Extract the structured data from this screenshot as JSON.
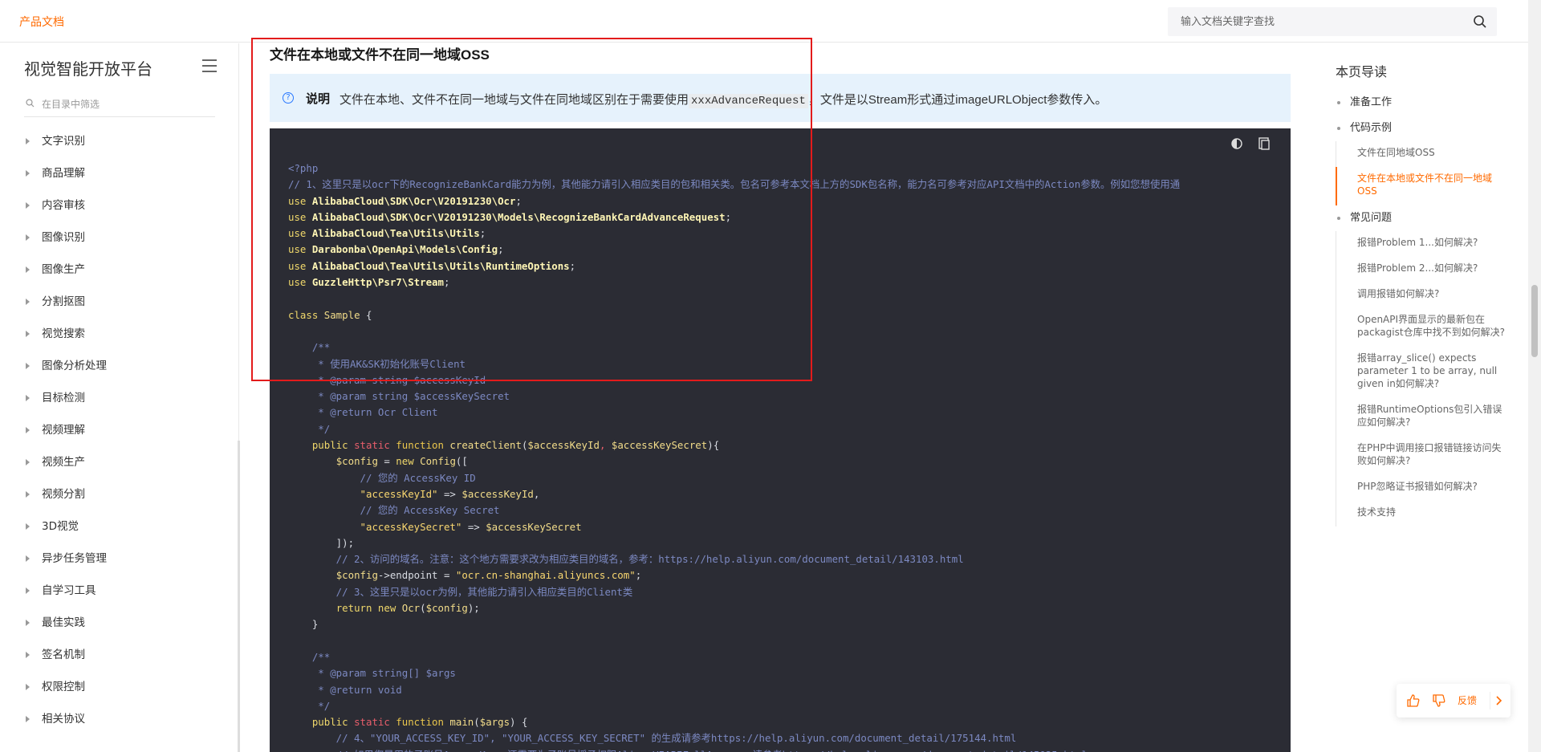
{
  "header": {
    "brand": "产品文档",
    "search_placeholder": "输入文档关键字查找"
  },
  "sidebar": {
    "title": "视觉智能开放平台",
    "filter_placeholder": "在目录中筛选",
    "items": [
      "文字识别",
      "商品理解",
      "内容审核",
      "图像识别",
      "图像生产",
      "分割抠图",
      "视觉搜索",
      "图像分析处理",
      "目标检测",
      "视频理解",
      "视频生产",
      "视频分割",
      "3D视觉",
      "异步任务管理",
      "自学习工具",
      "最佳实践",
      "签名机制",
      "权限控制",
      "相关协议"
    ]
  },
  "main": {
    "heading": "文件在本地或文件不在同一地域OSS",
    "note_label": "说明",
    "note_text_1": "文件在本地、文件不在同一地域与文件在同地域区别在于需要使用",
    "note_code": "xxxAdvanceRequest",
    "note_text_2": "，文件是以Stream形式通过imageURLObject参数传入。"
  },
  "code_lines": [
    [
      {
        "t": "<?php",
        "c": "c-ph"
      }
    ],
    [
      {
        "t": "// 1、这里只是以ocr下的RecognizeBankCard能力为例，其他能力请引入相应类目的包和相关类。包名可参考本文档上方的SDK包名称，能力名可参考对应API文档中的Action参数。例如您想使用通",
        "c": "c-cm"
      }
    ],
    [
      {
        "t": "use ",
        "c": "c-kw"
      },
      {
        "t": "AlibabaCloud\\SDK\\Ocr\\V20191230\\Ocr",
        "c": "c-mo"
      },
      {
        "t": ";",
        "c": "c-pl"
      }
    ],
    [
      {
        "t": "use ",
        "c": "c-kw"
      },
      {
        "t": "AlibabaCloud\\SDK\\Ocr\\V20191230\\Models\\RecognizeBankCardAdvanceRequest",
        "c": "c-mo"
      },
      {
        "t": ";",
        "c": "c-pl"
      }
    ],
    [
      {
        "t": "use ",
        "c": "c-kw"
      },
      {
        "t": "AlibabaCloud\\Tea\\Utils\\Utils",
        "c": "c-mo"
      },
      {
        "t": ";",
        "c": "c-pl"
      }
    ],
    [
      {
        "t": "use ",
        "c": "c-kw"
      },
      {
        "t": "Darabonba\\OpenApi\\Models\\Config",
        "c": "c-mo"
      },
      {
        "t": ";",
        "c": "c-pl"
      }
    ],
    [
      {
        "t": "use ",
        "c": "c-kw"
      },
      {
        "t": "AlibabaCloud\\Tea\\Utils\\Utils\\RuntimeOptions",
        "c": "c-mo"
      },
      {
        "t": ";",
        "c": "c-pl"
      }
    ],
    [
      {
        "t": "use ",
        "c": "c-kw"
      },
      {
        "t": "GuzzleHttp\\Psr7\\Stream",
        "c": "c-mo"
      },
      {
        "t": ";",
        "c": "c-pl"
      }
    ],
    [
      {
        "t": "",
        "c": "c-pl"
      }
    ],
    [
      {
        "t": "class ",
        "c": "c-kw"
      },
      {
        "t": "Sample",
        "c": "c-fn"
      },
      {
        "t": " {",
        "c": "c-pl"
      }
    ],
    [
      {
        "t": "",
        "c": "c-pl"
      }
    ],
    [
      {
        "t": "    /**",
        "c": "c-cm"
      }
    ],
    [
      {
        "t": "     * 使用AK&SK初始化账号Client",
        "c": "c-cm"
      }
    ],
    [
      {
        "t": "     * @param string $accessKeyId",
        "c": "c-cm"
      }
    ],
    [
      {
        "t": "     * @param string $accessKeySecret",
        "c": "c-cm"
      }
    ],
    [
      {
        "t": "     * @return Ocr Client",
        "c": "c-cm"
      }
    ],
    [
      {
        "t": "     */",
        "c": "c-cm"
      }
    ],
    [
      {
        "t": "    public ",
        "c": "c-kw"
      },
      {
        "t": "static ",
        "c": "c-rd"
      },
      {
        "t": "function ",
        "c": "c-pn"
      },
      {
        "t": "createClient",
        "c": "c-fn"
      },
      {
        "t": "(",
        "c": "c-pl"
      },
      {
        "t": "$accessKeyId",
        "c": "c-vr"
      },
      {
        "t": ", ",
        "c": "c-rd"
      },
      {
        "t": "$accessKeySecret",
        "c": "c-vr"
      },
      {
        "t": "){",
        "c": "c-pl"
      }
    ],
    [
      {
        "t": "        ",
        "c": "c-pl"
      },
      {
        "t": "$config",
        "c": "c-vr"
      },
      {
        "t": " = ",
        "c": "c-pl"
      },
      {
        "t": "new ",
        "c": "c-kw"
      },
      {
        "t": "Config",
        "c": "c-fn"
      },
      {
        "t": "([",
        "c": "c-pl"
      }
    ],
    [
      {
        "t": "            // 您的 AccessKey ID",
        "c": "c-cm"
      }
    ],
    [
      {
        "t": "            ",
        "c": "c-pl"
      },
      {
        "t": "\"accessKeyId\"",
        "c": "c-st"
      },
      {
        "t": " => ",
        "c": "c-pl"
      },
      {
        "t": "$accessKeyId",
        "c": "c-vr"
      },
      {
        "t": ",",
        "c": "c-pl"
      }
    ],
    [
      {
        "t": "            // 您的 AccessKey Secret",
        "c": "c-cm"
      }
    ],
    [
      {
        "t": "            ",
        "c": "c-pl"
      },
      {
        "t": "\"accessKeySecret\"",
        "c": "c-st"
      },
      {
        "t": " => ",
        "c": "c-pl"
      },
      {
        "t": "$accessKeySecret",
        "c": "c-vr"
      }
    ],
    [
      {
        "t": "        ]);",
        "c": "c-pl"
      }
    ],
    [
      {
        "t": "        // 2、访问的域名。注意：这个地方需要求改为相应类目的域名，参考：https://help.aliyun.com/document_detail/143103.html",
        "c": "c-cm"
      }
    ],
    [
      {
        "t": "        ",
        "c": "c-pl"
      },
      {
        "t": "$config",
        "c": "c-vr"
      },
      {
        "t": "->endpoint = ",
        "c": "c-pl"
      },
      {
        "t": "\"ocr.cn-shanghai.aliyuncs.com\"",
        "c": "c-st"
      },
      {
        "t": ";",
        "c": "c-pl"
      }
    ],
    [
      {
        "t": "        // 3、这里只是以ocr为例，其他能力请引入相应类目的Client类",
        "c": "c-cm"
      }
    ],
    [
      {
        "t": "        ",
        "c": "c-pl"
      },
      {
        "t": "return ",
        "c": "c-kw"
      },
      {
        "t": "new ",
        "c": "c-kw"
      },
      {
        "t": "Ocr",
        "c": "c-fn"
      },
      {
        "t": "(",
        "c": "c-pl"
      },
      {
        "t": "$config",
        "c": "c-vr"
      },
      {
        "t": ");",
        "c": "c-pl"
      }
    ],
    [
      {
        "t": "    }",
        "c": "c-pl"
      }
    ],
    [
      {
        "t": "",
        "c": "c-pl"
      }
    ],
    [
      {
        "t": "    /**",
        "c": "c-cm"
      }
    ],
    [
      {
        "t": "     * @param string[] $args",
        "c": "c-cm"
      }
    ],
    [
      {
        "t": "     * @return void",
        "c": "c-cm"
      }
    ],
    [
      {
        "t": "     */",
        "c": "c-cm"
      }
    ],
    [
      {
        "t": "    public ",
        "c": "c-kw"
      },
      {
        "t": "static ",
        "c": "c-rd"
      },
      {
        "t": "function ",
        "c": "c-pn"
      },
      {
        "t": "main",
        "c": "c-fn"
      },
      {
        "t": "(",
        "c": "c-pl"
      },
      {
        "t": "$args",
        "c": "c-vr"
      },
      {
        "t": ") {",
        "c": "c-pl"
      }
    ],
    [
      {
        "t": "        // 4、\"YOUR_ACCESS_KEY_ID\", \"YOUR_ACCESS_KEY_SECRET\" 的生成请参考https://help.aliyun.com/document_detail/175144.html",
        "c": "c-cm"
      }
    ],
    [
      {
        "t": "        // 如果您是用的子账号AccessKey，还需要为子账号授予权限AliyunVIAPIFullAccess，请参考https://help.aliyun.com/document_detail/145025.html",
        "c": "c-cm"
      }
    ]
  ],
  "toc": {
    "title": "本页导读",
    "items": [
      {
        "label": "准备工作",
        "level": 1
      },
      {
        "label": "代码示例",
        "level": 1
      },
      {
        "label": "文件在同地域OSS",
        "level": 2
      },
      {
        "label": "文件在本地或文件不在同一地域OSS",
        "level": 2,
        "active": true
      },
      {
        "label": "常见问题",
        "level": 1
      },
      {
        "label": "报错Problem 1...如何解决?",
        "level": 2
      },
      {
        "label": "报错Problem 2...如何解决?",
        "level": 2
      },
      {
        "label": "调用报错如何解决?",
        "level": 2
      },
      {
        "label": "OpenAPI界面显示的最新包在packagist仓库中找不到如何解决?",
        "level": 2
      },
      {
        "label": "报错array_slice() expects parameter 1 to be array, null given in如何解决?",
        "level": 2
      },
      {
        "label": "报错RuntimeOptions包引入错误应如何解决?",
        "level": 2
      },
      {
        "label": "在PHP中调用接口报错链接访问失败如何解决?",
        "level": 2
      },
      {
        "label": "PHP忽略证书报错如何解决?",
        "level": 2
      },
      {
        "label": "技术支持",
        "level": 2
      }
    ]
  },
  "feedback": {
    "label": "反馈"
  },
  "colors": {
    "brand": "#ff6a00",
    "highlight_box": "#e31b1b",
    "note_bg": "#e6f2fc",
    "code_bg": "#2b2c34"
  }
}
